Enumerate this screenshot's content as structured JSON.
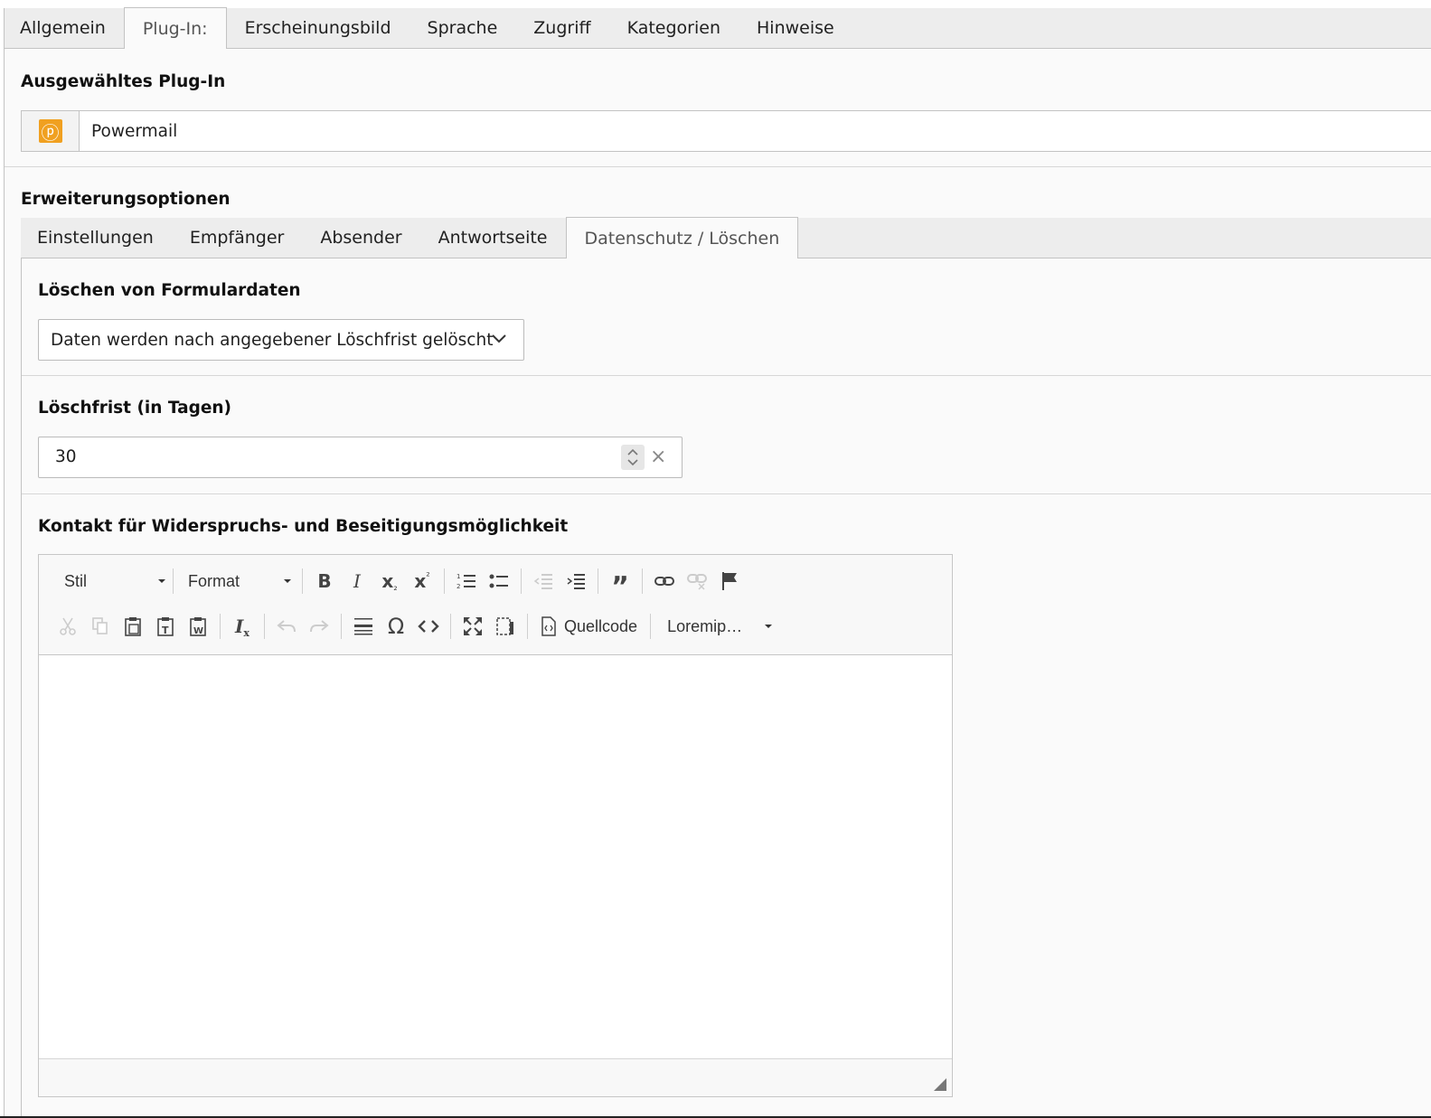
{
  "top_tabs": [
    {
      "label": "Allgemein"
    },
    {
      "label": "Plug-In:"
    },
    {
      "label": "Erscheinungsbild"
    },
    {
      "label": "Sprache"
    },
    {
      "label": "Zugriff"
    },
    {
      "label": "Kategorien"
    },
    {
      "label": "Hinweise"
    }
  ],
  "active_top_tab": "Plug-In:",
  "plugin": {
    "section_title": "Ausgewähltes Plug-In",
    "icon": "powermail-icon",
    "icon_glyph": "ⓟ",
    "icon_color": "#f0a020",
    "name": "Powermail"
  },
  "extension": {
    "section_title": "Erweiterungsoptionen",
    "tabs": [
      {
        "label": "Einstellungen"
      },
      {
        "label": "Empfänger"
      },
      {
        "label": "Absender"
      },
      {
        "label": "Antwortseite"
      },
      {
        "label": "Datenschutz / Löschen"
      }
    ],
    "active_tab": "Datenschutz / Löschen"
  },
  "deletion": {
    "label": "Löschen von Formulardaten",
    "selected": "Daten werden nach angegebener Löschfrist gelöscht"
  },
  "retention": {
    "label": "Löschfrist (in Tagen)",
    "value": "30"
  },
  "contact": {
    "label": "Kontakt für Widerspruchs- und Beseitigungsmöglichkeit",
    "toolbar": {
      "style_combo": "Stil",
      "format_combo": "Format",
      "source_label": "Quellcode",
      "lorem_combo": "Loremip…"
    },
    "content": ""
  }
}
